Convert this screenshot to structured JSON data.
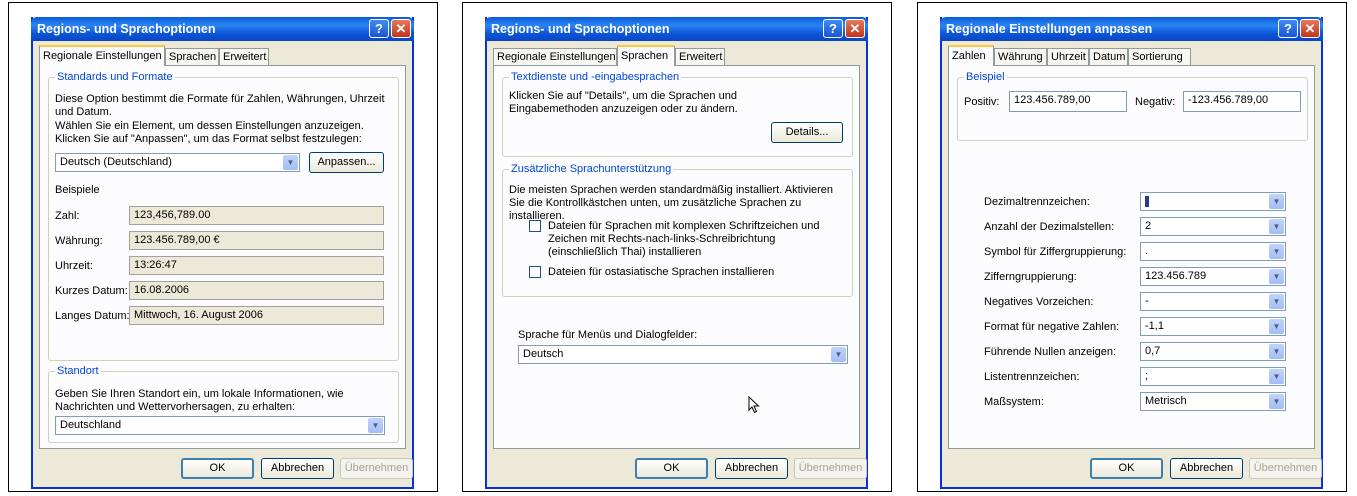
{
  "dialog1": {
    "title": "Regions- und Sprachoptionen",
    "tabs": [
      "Regionale Einstellungen",
      "Sprachen",
      "Erweitert"
    ],
    "group1_title": "Standards und Formate",
    "group1_desc1": "Diese Option bestimmt die Formate für Zahlen, Währungen, Uhrzeit und Datum.",
    "group1_desc2": "Wählen Sie ein Element, um dessen Einstellungen anzuzeigen. Klicken Sie auf \"Anpassen\", um das Format selbst festzulegen:",
    "locale_value": "Deutsch (Deutschland)",
    "customize_label": "Anpassen...",
    "examples_label": "Beispiele",
    "examples": [
      {
        "label": "Zahl:",
        "value": "123,456,789.00"
      },
      {
        "label": "Währung:",
        "value": "123.456.789,00 €"
      },
      {
        "label": "Uhrzeit:",
        "value": "13:26:47"
      },
      {
        "label": "Kurzes Datum:",
        "value": "16.08.2006"
      },
      {
        "label": "Langes Datum:",
        "value": "Mittwoch, 16. August 2006"
      }
    ],
    "group2_title": "Standort",
    "group2_desc": "Geben Sie Ihren Standort ein, um lokale Informationen, wie Nachrichten und Wettervorhersagen, zu erhalten:",
    "location_value": "Deutschland",
    "ok": "OK",
    "cancel": "Abbrechen",
    "apply": "Übernehmen"
  },
  "dialog2": {
    "title": "Regions- und Sprachoptionen",
    "tabs": [
      "Regionale Einstellungen",
      "Sprachen",
      "Erweitert"
    ],
    "group1_title": "Textdienste und -eingabesprachen",
    "group1_desc": "Klicken Sie auf \"Details\", um die Sprachen und Eingabemethoden anzuzeigen oder zu ändern.",
    "details_label": "Details...",
    "group2_title": "Zusätzliche Sprachunterstützung",
    "group2_desc": "Die meisten Sprachen werden standardmäßig installiert. Aktivieren Sie die Kontrollkästchen unten, um zusätzliche Sprachen zu installieren.",
    "check1": "Dateien für Sprachen mit komplexen Schriftzeichen und Zeichen mit Rechts-nach-links-Schreibrichtung (einschließlich Thai) installieren",
    "check2": "Dateien für ostasiatische Sprachen installieren",
    "menu_lang_label": "Sprache für Menüs und Dialogfelder:",
    "menu_lang_value": "Deutsch",
    "ok": "OK",
    "cancel": "Abbrechen",
    "apply": "Übernehmen"
  },
  "dialog3": {
    "title": "Regionale Einstellungen anpassen",
    "tabs": [
      "Zahlen",
      "Währung",
      "Uhrzeit",
      "Datum",
      "Sortierung"
    ],
    "example_title": "Beispiel",
    "positive_label": "Positiv:",
    "positive_value": "123.456.789,00",
    "negative_label": "Negativ:",
    "negative_value": "-123.456.789,00",
    "fields": [
      {
        "label": "Dezimaltrennzeichen:",
        "value": ""
      },
      {
        "label": "Anzahl der Dezimalstellen:",
        "value": "2"
      },
      {
        "label": "Symbol für Ziffergruppierung:",
        "value": "."
      },
      {
        "label": "Zifferngruppierung:",
        "value": "123.456.789"
      },
      {
        "label": "Negatives Vorzeichen:",
        "value": "-"
      },
      {
        "label": "Format für negative Zahlen:",
        "value": "-1,1"
      },
      {
        "label": "Führende Nullen anzeigen:",
        "value": "0,7"
      },
      {
        "label": "Listentrennzeichen:",
        "value": ";"
      },
      {
        "label": "Maßsystem:",
        "value": "Metrisch"
      }
    ],
    "ok": "OK",
    "cancel": "Abbrechen",
    "apply": "Übernehmen"
  },
  "icons": {
    "help": "?",
    "close": "✕",
    "dropdown": "▼",
    "cursor": "mouse-pointer-icon"
  },
  "colors": {
    "titlebar": "#0a5bd6",
    "group_title": "#0046d5",
    "dialog_bg": "#ece9d8"
  }
}
